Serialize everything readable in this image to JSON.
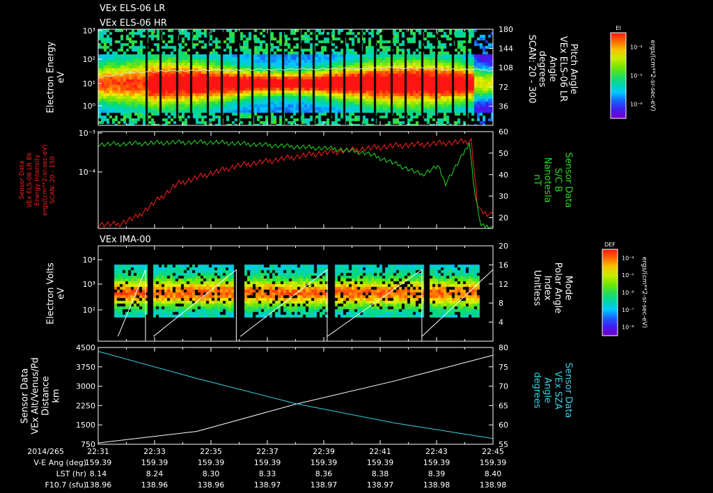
{
  "colors": {
    "background": "#000000",
    "foreground": "#ffffff",
    "red": "#ff2020",
    "green": "#22dd22",
    "cyan": "#33d6e6"
  },
  "header": {
    "title_lr": "VEx ELS-06 LR",
    "title_hr": "VEx ELS-06 HR"
  },
  "chart_data": [
    {
      "type": "heatmap",
      "name": "VEx ELS-06 electron spectrogram",
      "ylabel": [
        "Electron Energy",
        "eV"
      ],
      "yscale": "log",
      "ylim": [
        1,
        1000
      ],
      "y_ticks": [
        "10⁰",
        "10¹",
        "10²",
        "10³"
      ],
      "y2label": [
        "Pitch Angle",
        "VEx ELS-06 LR",
        "Angle",
        "degrees",
        "SCAN: 20 - 300"
      ],
      "y2lim": [
        0,
        180
      ],
      "y2_ticks": [
        36,
        72,
        108,
        144,
        180
      ],
      "colorbar": {
        "label": "El",
        "unit": "ergs/(cm**2-sr-sec-eV)",
        "ticks": [
          "10⁻⁴",
          "10⁻⁵",
          "10⁻⁶"
        ]
      },
      "overlay_line": {
        "color": "#dddddd",
        "y_points": [
          [
            0,
            90
          ],
          [
            0.1,
            100
          ],
          [
            0.25,
            103
          ],
          [
            0.5,
            105
          ],
          [
            0.75,
            108
          ],
          [
            0.9,
            105
          ],
          [
            0.97,
            104
          ],
          [
            1.0,
            103
          ]
        ]
      }
    },
    {
      "type": "line",
      "name": "Sensor data",
      "ylabel": [
        "Sensor Data",
        "VEx ELS-06 LR Bk",
        "Energy Intensity",
        "ergs/(cm**2-sr-sec-eV)",
        "SCAN: 20 - 150"
      ],
      "yscale": "log",
      "y_ticks": [
        "10⁻³",
        "10⁻⁴"
      ],
      "y2label": [
        "Sensor Data",
        "S/C B",
        "Nanotesla",
        "nT"
      ],
      "y2lim": [
        15,
        60
      ],
      "y2_ticks": [
        20,
        30,
        40,
        50,
        60
      ],
      "series": [
        {
          "color": "#ff2020",
          "axis": "left",
          "points": [
            [
              0,
              -5.3
            ],
            [
              0.05,
              -5.3
            ],
            [
              0.1,
              -5.1
            ],
            [
              0.15,
              -4.7
            ],
            [
              0.2,
              -4.3
            ],
            [
              0.28,
              -4.05
            ],
            [
              0.35,
              -3.85
            ],
            [
              0.45,
              -3.7
            ],
            [
              0.55,
              -3.55
            ],
            [
              0.65,
              -3.45
            ],
            [
              0.75,
              -3.35
            ],
            [
              0.85,
              -3.3
            ],
            [
              0.93,
              -3.25
            ],
            [
              0.945,
              -3.22
            ],
            [
              0.955,
              -4.2
            ],
            [
              0.96,
              -4.8
            ],
            [
              0.97,
              -5.0
            ],
            [
              1.0,
              -5.05
            ]
          ]
        },
        {
          "color": "#22dd22",
          "axis": "right",
          "points": [
            [
              0,
              54
            ],
            [
              0.1,
              54.5
            ],
            [
              0.2,
              55
            ],
            [
              0.3,
              55
            ],
            [
              0.4,
              54
            ],
            [
              0.5,
              53
            ],
            [
              0.6,
              52
            ],
            [
              0.68,
              50
            ],
            [
              0.74,
              46
            ],
            [
              0.78,
              43
            ],
            [
              0.82,
              40
            ],
            [
              0.86,
              44
            ],
            [
              0.88,
              36
            ],
            [
              0.92,
              48
            ],
            [
              0.94,
              55
            ],
            [
              0.955,
              30
            ],
            [
              0.97,
              16
            ],
            [
              1.0,
              16
            ]
          ]
        }
      ]
    },
    {
      "type": "heatmap",
      "name": "VEx IMA-00 ion spectrogram",
      "title": "VEx IMA-00",
      "ylabel": [
        "Electron Volts",
        "eV"
      ],
      "yscale": "log",
      "y_ticks": [
        "10²",
        "10³",
        "10⁴"
      ],
      "y2label": [
        "Mode",
        "Polar Angle",
        "Index",
        "Unitless"
      ],
      "y2lim": [
        0,
        20
      ],
      "y2_ticks": [
        4,
        8,
        12,
        16,
        20
      ],
      "colorbar": {
        "label": "DEF",
        "unit": "ergs/(cm**2-sr-sec-eV)",
        "ticks": [
          "10⁻⁴",
          "10⁻⁵",
          "10⁻⁶",
          "10⁻⁷",
          "10⁻⁸"
        ]
      }
    },
    {
      "type": "line",
      "name": "Altitude and SZA",
      "ylabel": [
        "Sensor Data",
        "VEx Alt/Venus/Pd",
        "Distance",
        "km"
      ],
      "ylim": [
        750,
        4500
      ],
      "y_ticks": [
        750,
        1500,
        2250,
        3000,
        3750,
        4500
      ],
      "y2label": [
        "Sensor Data",
        "VEx SZA",
        "Angle",
        "degrees"
      ],
      "y2lim": [
        55,
        80
      ],
      "y2_ticks": [
        55,
        60,
        65,
        70,
        75,
        80
      ],
      "series": [
        {
          "color": "#ffffff",
          "axis": "left",
          "points": [
            [
              0,
              800
            ],
            [
              0.25,
              1250
            ],
            [
              0.5,
              2300
            ],
            [
              0.75,
              3200
            ],
            [
              1.0,
              4200
            ]
          ]
        },
        {
          "color": "#33d6e6",
          "axis": "right",
          "points": [
            [
              0,
              79
            ],
            [
              0.25,
              72
            ],
            [
              0.5,
              65.5
            ],
            [
              0.75,
              60.5
            ],
            [
              1.0,
              56.5
            ]
          ]
        }
      ]
    }
  ],
  "time_axis": {
    "date": "2014/265",
    "times": [
      "22:31",
      "22:33",
      "22:35",
      "22:37",
      "22:39",
      "22:41",
      "22:43",
      "22:45"
    ],
    "rows": [
      {
        "label": "V-E Ang (deg)",
        "values": [
          "159.39",
          "159.39",
          "159.39",
          "159.39",
          "159.39",
          "159.39",
          "159.39",
          "159.39"
        ]
      },
      {
        "label": "LST (hr)",
        "values": [
          "8.14",
          "8.24",
          "8.30",
          "8.33",
          "8.36",
          "8.38",
          "8.39",
          "8.40"
        ]
      },
      {
        "label": "F10.7 (sfu)",
        "values": [
          "138.96",
          "138.96",
          "138.96",
          "138.97",
          "138.97",
          "138.97",
          "138.98",
          "138.98"
        ]
      }
    ]
  }
}
